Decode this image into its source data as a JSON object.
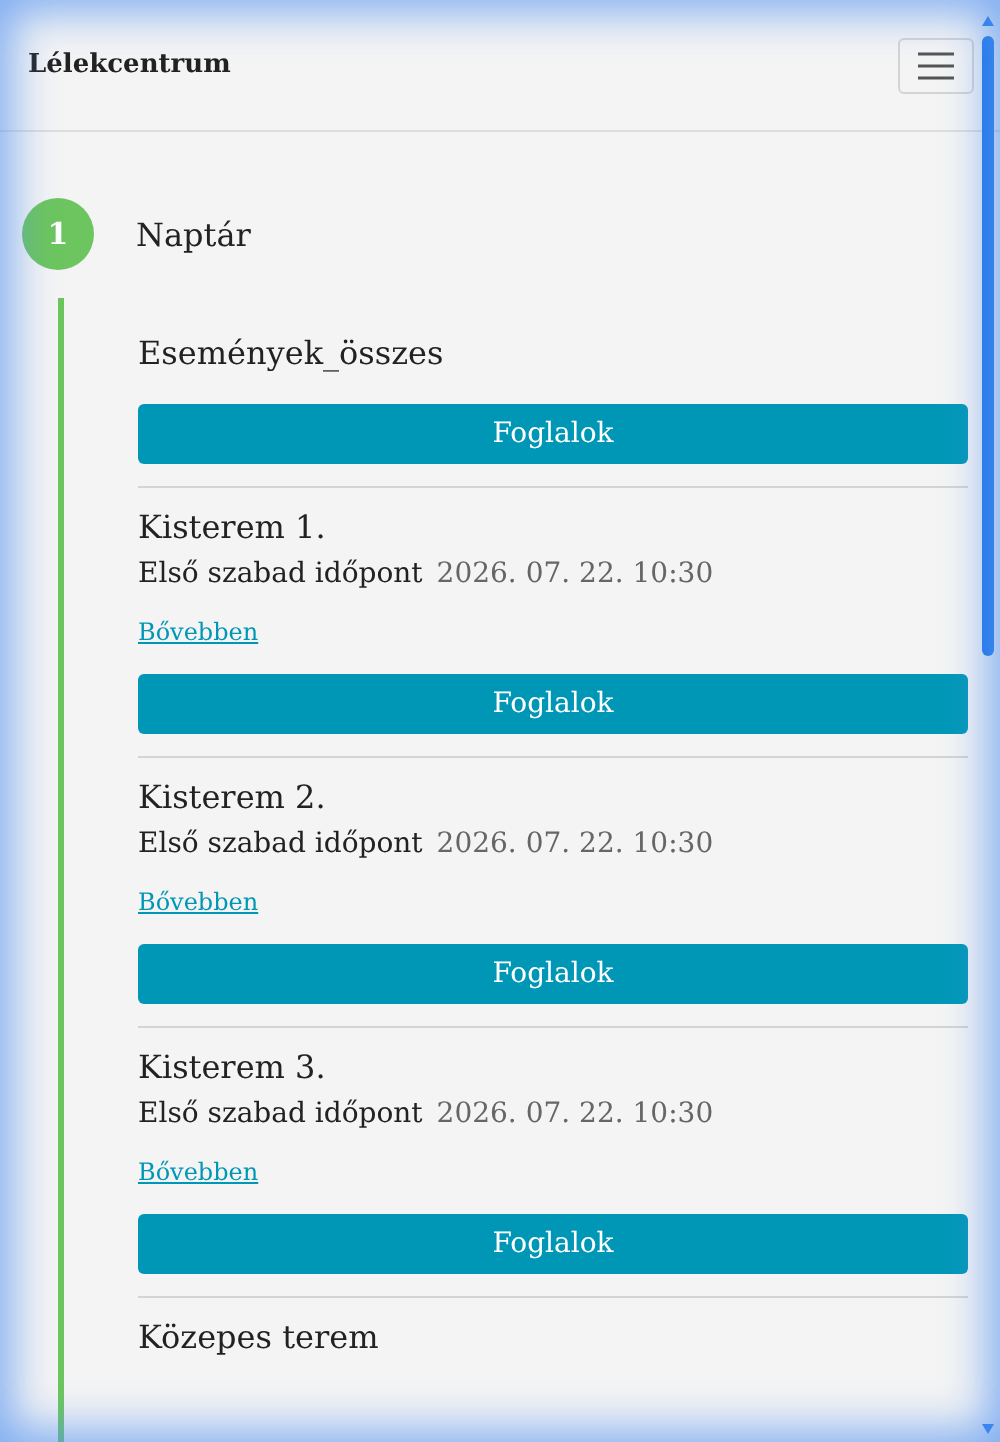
{
  "navbar": {
    "brand": "Lélekcentrum"
  },
  "step": {
    "number": "1",
    "title": "Naptár"
  },
  "section": {
    "title": "Események_összes",
    "button": "Foglalok"
  },
  "rooms": [
    {
      "title": "Kisterem 1.",
      "label": "Első szabad időpont",
      "date": "2026. 07. 22. 10:30",
      "link": "Bővebben",
      "button": "Foglalok"
    },
    {
      "title": "Kisterem 2.",
      "label": "Első szabad időpont",
      "date": "2026. 07. 22. 10:30",
      "link": "Bővebben",
      "button": "Foglalok"
    },
    {
      "title": "Kisterem 3.",
      "label": "Első szabad időpont",
      "date": "2026. 07. 22. 10:30",
      "link": "Bővebben",
      "button": "Foglalok"
    },
    {
      "title": "Közepes terem"
    }
  ]
}
